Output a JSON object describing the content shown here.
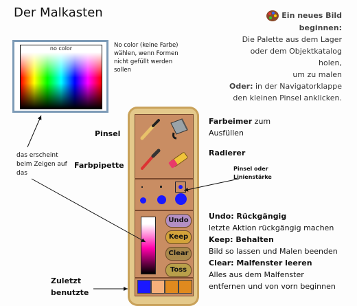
{
  "page_title": "Der Malkasten",
  "hint": {
    "heading": "Ein neues Bild beginnen:",
    "line1": "Die Palette aus dem Lager",
    "line2": "oder dem Objektkatalog holen,",
    "line3": "um zu malen",
    "oder_label": "Oder:",
    "line4": " in der Navigatorklappe",
    "line5": "den kleinen Pinsel anklicken."
  },
  "palette": {
    "no_color_label": "no color"
  },
  "nocolor_note": [
    "No color (keine Farbe)",
    "wählen, wenn Formen",
    "nicht gefüllt werden",
    "sollen"
  ],
  "labels": {
    "pinsel": "Pinsel",
    "farbpipette": "Farbpipette",
    "farbeimer": "Farbeimer",
    "farbeimer_rest1": " zum",
    "farbeimer_rest2": "Ausfüllen",
    "radierer": "Radierer",
    "pinsel_oder": "Pinsel oder",
    "linienstaerke": "Linienstärke",
    "zuletzt": "Zuletzt",
    "benutzte": "benutzte"
  },
  "hover_note": [
    "das erscheint",
    "beim Zeigen auf",
    "das"
  ],
  "buttons": {
    "undo": "Undo",
    "keep": "Keep",
    "clear": "Clear",
    "toss": "Toss"
  },
  "right_text": {
    "undo_label": "Undo: Rückgängig",
    "undo_desc": "letzte Aktion rückgängig machen",
    "keep_label": "Keep: Behalten",
    "keep_desc": "Bild so lassen und Malen beenden",
    "clear_label": "Clear: Malfenster leeren",
    "clear_desc1": "Alles aus dem Malfenster",
    "clear_desc2": "entfernen und von vorn beginnen"
  },
  "colors": {
    "accent_blue": "#1a18ff",
    "toolbox": "#e4c98b",
    "panel": "#c98d63",
    "button": "#b38fc4"
  },
  "recent_colors": [
    "#1a18ff",
    "#f5b07a",
    "#e08a1e",
    "#e08a1e"
  ],
  "icons": [
    "palette-icon",
    "brush-icon",
    "paint-bucket-icon",
    "eyedropper-icon",
    "eraser-icon"
  ]
}
